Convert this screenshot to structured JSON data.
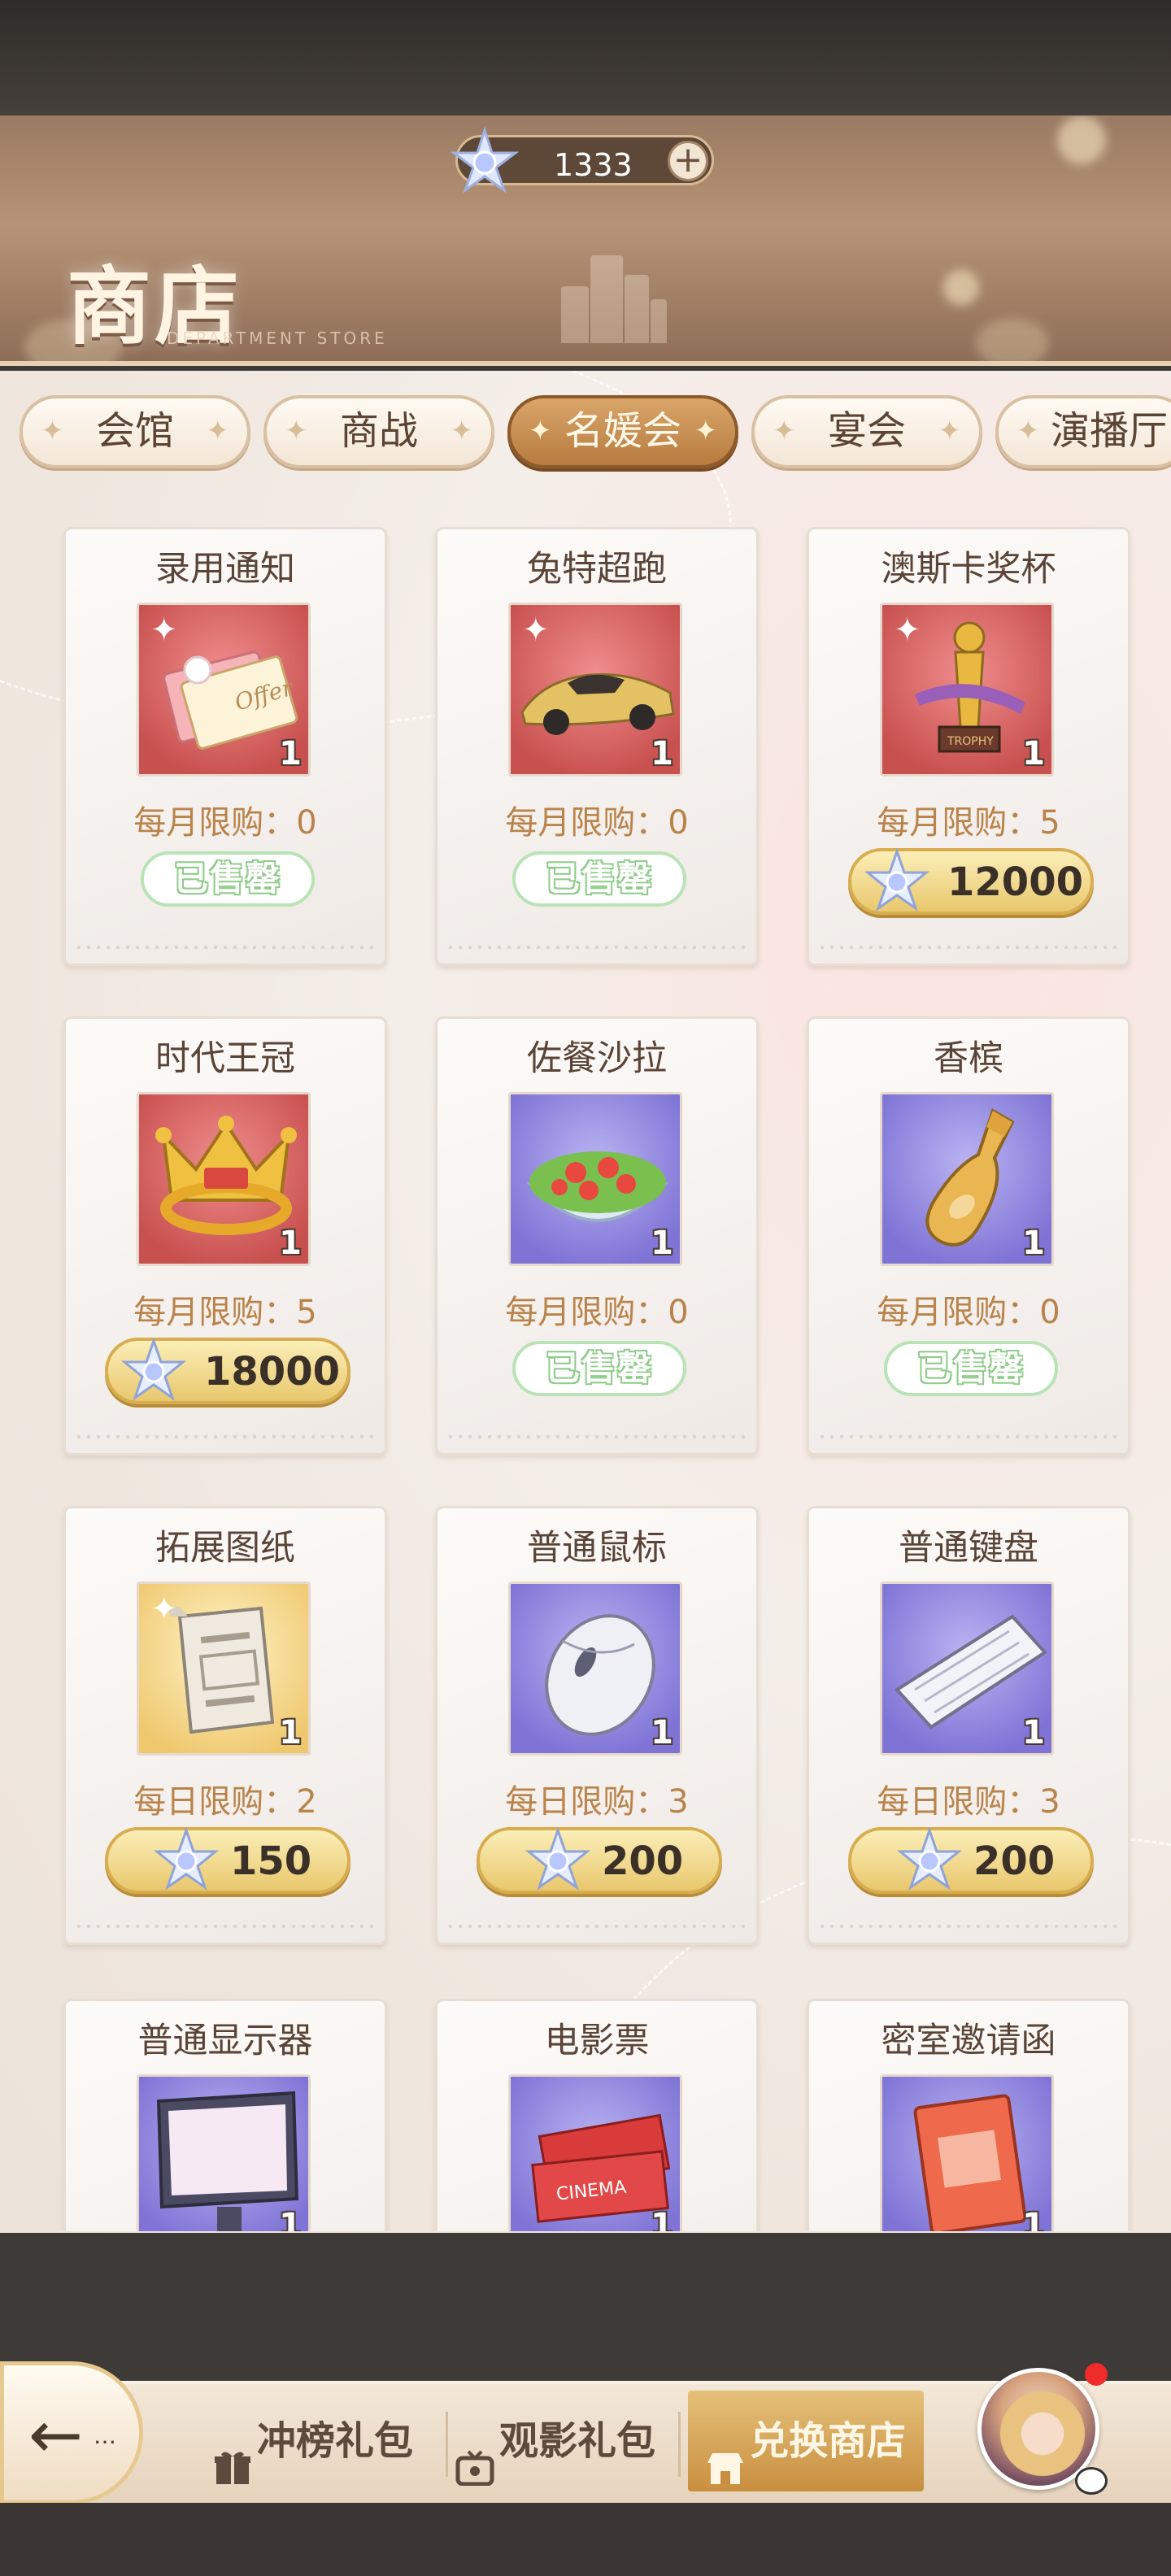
{
  "currency": {
    "amount": "1333",
    "plus_label": "+"
  },
  "banner": {
    "title": "商店",
    "subtitle": "DEPARTMENT STORE"
  },
  "tabs": [
    {
      "label": "会馆",
      "active": false
    },
    {
      "label": "商战",
      "active": false
    },
    {
      "label": "名媛会",
      "active": true
    },
    {
      "label": "宴会",
      "active": false
    },
    {
      "label": "演播厅",
      "active": false
    }
  ],
  "items": [
    {
      "name": "录用通知",
      "qty": "1",
      "limit": "每月限购：0",
      "sold_label": "已售罄",
      "color": "#d9605e",
      "icon": "offer-letter-icon"
    },
    {
      "name": "兔特超跑",
      "qty": "1",
      "limit": "每月限购：0",
      "sold_label": "已售罄",
      "color": "#d9605e",
      "icon": "sports-car-icon"
    },
    {
      "name": "澳斯卡奖杯",
      "qty": "1",
      "limit": "每月限购：5",
      "price": "12000",
      "color": "#d9605e",
      "icon": "trophy-icon"
    },
    {
      "name": "时代王冠",
      "qty": "1",
      "limit": "每月限购：5",
      "price": "18000",
      "color": "#d9605e",
      "icon": "crown-icon"
    },
    {
      "name": "佐餐沙拉",
      "qty": "1",
      "limit": "每月限购：0",
      "sold_label": "已售罄",
      "color": "#8a7fdc",
      "icon": "salad-icon"
    },
    {
      "name": "香槟",
      "qty": "1",
      "limit": "每月限购：0",
      "sold_label": "已售罄",
      "color": "#8a7fdc",
      "icon": "champagne-icon"
    },
    {
      "name": "拓展图纸",
      "qty": "1",
      "limit": "每日限购：2",
      "price": "150",
      "color": "#f0c970",
      "icon": "blueprint-icon"
    },
    {
      "name": "普通鼠标",
      "qty": "1",
      "limit": "每日限购：3",
      "price": "200",
      "color": "#8a7fdc",
      "icon": "mouse-icon"
    },
    {
      "name": "普通键盘",
      "qty": "1",
      "limit": "每日限购：3",
      "price": "200",
      "color": "#8a7fdc",
      "icon": "keyboard-icon"
    },
    {
      "name": "普通显示器",
      "qty": "1",
      "color": "#8a7fdc",
      "icon": "monitor-icon"
    },
    {
      "name": "电影票",
      "qty": "1",
      "color": "#8a7fdc",
      "icon": "movie-ticket-icon"
    },
    {
      "name": "密室邀请函",
      "qty": "1",
      "color": "#8a7fdc",
      "icon": "invitation-icon"
    }
  ],
  "bottom_nav": {
    "back_icon": "back-arrow-icon",
    "items": [
      {
        "label": "冲榜礼包",
        "icon": "gift-icon"
      },
      {
        "label": "观影礼包",
        "icon": "tv-icon"
      },
      {
        "label": "兑换商店",
        "icon": "shop-icon",
        "active": true
      }
    ]
  },
  "colors": {
    "accent": "#c58a48",
    "sold": "#8fcc8a",
    "limit": "#b9834a"
  }
}
